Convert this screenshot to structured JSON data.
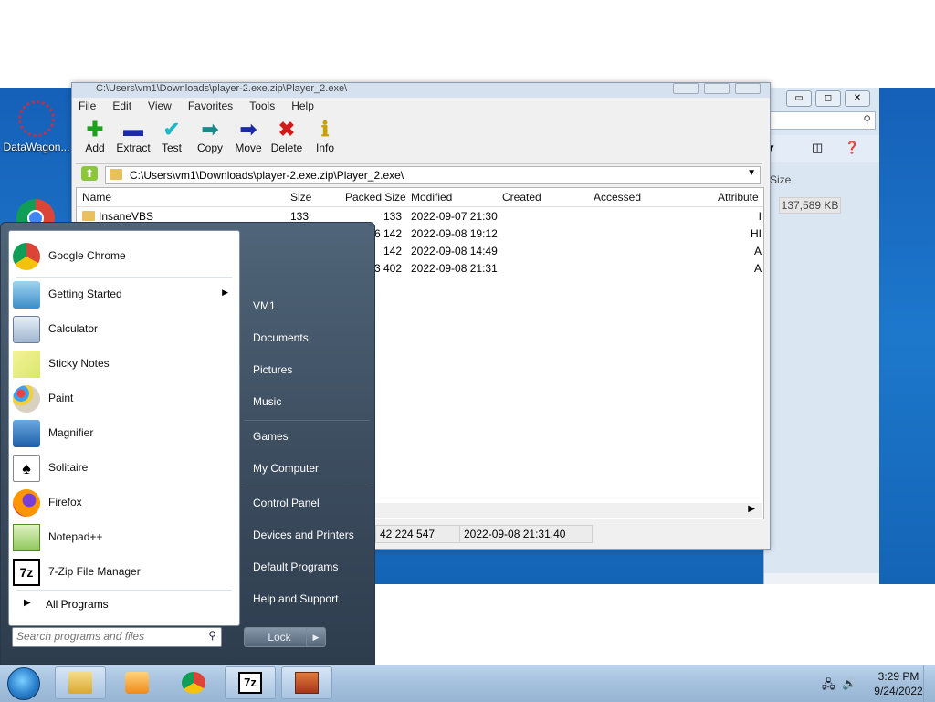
{
  "desktop": {
    "icons": [
      {
        "label": "DataWagon..."
      }
    ]
  },
  "explorer_bg": {
    "column_size": "Size",
    "size_value": "137,589 KB"
  },
  "zip": {
    "title": "C:\\Users\\vm1\\Downloads\\player-2.exe.zip\\Player_2.exe\\",
    "menu": [
      "File",
      "Edit",
      "View",
      "Favorites",
      "Tools",
      "Help"
    ],
    "toolbar": [
      {
        "label": "Add",
        "icon": "plus-icon",
        "color": "#1aa31a",
        "glyph": "✚"
      },
      {
        "label": "Extract",
        "icon": "minus-icon",
        "color": "#1c2aa8",
        "glyph": "▬"
      },
      {
        "label": "Test",
        "icon": "check-icon",
        "color": "#1eb8c8",
        "glyph": "✔"
      },
      {
        "label": "Copy",
        "icon": "copy-arrow-icon",
        "color": "#1a8a8a",
        "glyph": "➡"
      },
      {
        "label": "Move",
        "icon": "move-arrow-icon",
        "color": "#1c2aa8",
        "glyph": "➡"
      },
      {
        "label": "Delete",
        "icon": "delete-x-icon",
        "color": "#d21a1a",
        "glyph": "✖"
      },
      {
        "label": "Info",
        "icon": "info-icon",
        "color": "#c8a000",
        "glyph": "ℹ"
      }
    ],
    "address": "C:\\Users\\vm1\\Downloads\\player-2.exe.zip\\Player_2.exe\\",
    "columns": [
      "Name",
      "Size",
      "Packed Size",
      "Modified",
      "Created",
      "Accessed",
      "Attribute"
    ],
    "rows": [
      {
        "name": "InsaneVBS",
        "size": "133",
        "packed": "133",
        "modified": "2022-09-07 21:30",
        "attr": "I"
      },
      {
        "name": "",
        "size": "",
        "packed": "6 142",
        "modified": "2022-09-08 19:12",
        "attr": "HI"
      },
      {
        "name": "",
        "size": "",
        "packed": "142",
        "modified": "2022-09-08 14:49",
        "attr": "A"
      },
      {
        "name": "",
        "size": "",
        "packed": "3 402",
        "modified": "2022-09-08 21:31",
        "attr": "A"
      }
    ],
    "status": {
      "size": "42 224 547",
      "modified": "2022-09-08 21:31:40"
    }
  },
  "start_menu": {
    "programs": [
      {
        "label": "Google Chrome",
        "icon": "chrome-icon",
        "has_submenu": false
      },
      {
        "label": "Getting Started",
        "icon": "getting-started-icon",
        "has_submenu": true
      },
      {
        "label": "Calculator",
        "icon": "calculator-icon",
        "has_submenu": false
      },
      {
        "label": "Sticky Notes",
        "icon": "sticky-notes-icon",
        "has_submenu": false
      },
      {
        "label": "Paint",
        "icon": "paint-icon",
        "has_submenu": false
      },
      {
        "label": "Magnifier",
        "icon": "magnifier-icon",
        "has_submenu": false
      },
      {
        "label": "Solitaire",
        "icon": "solitaire-icon",
        "has_submenu": false
      },
      {
        "label": "Firefox",
        "icon": "firefox-icon",
        "has_submenu": false
      },
      {
        "label": "Notepad++",
        "icon": "notepadpp-icon",
        "has_submenu": false
      },
      {
        "label": "7-Zip File Manager",
        "icon": "7zip-icon",
        "has_submenu": false
      }
    ],
    "all_programs": "All Programs",
    "search_placeholder": "Search programs and files",
    "right_items": [
      "VM1",
      "Documents",
      "Pictures",
      "Music",
      "Games",
      "My Computer",
      "Control Panel",
      "Devices and Printers",
      "Default Programs",
      "Help and Support"
    ],
    "lock_label": "Lock"
  },
  "taskbar": {
    "buttons": [
      "file-explorer",
      "media-player",
      "chrome",
      "7zip",
      "installer"
    ],
    "time": "3:29 PM",
    "date": "9/24/2022"
  }
}
